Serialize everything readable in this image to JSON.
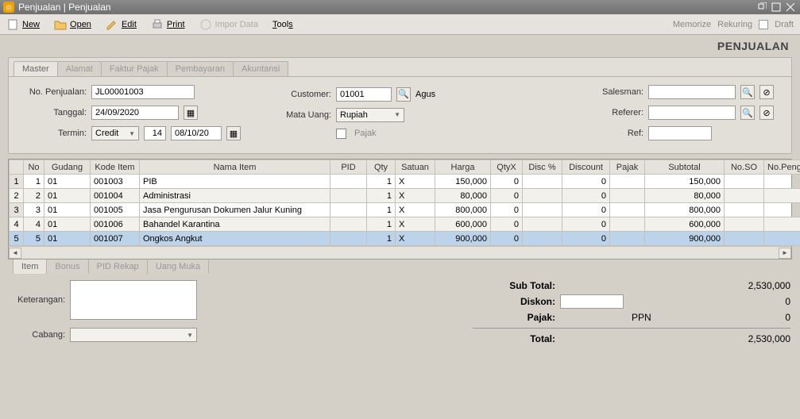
{
  "window": {
    "title": "Penjualan | Penjualan"
  },
  "toolbar": {
    "new": "New",
    "open": "Open",
    "edit": "Edit",
    "print": "Print",
    "impor": "Impor Data",
    "tools": "Tools",
    "memorize": "Memorize",
    "rekuring": "Rekuring",
    "draft": "Draft"
  },
  "page": {
    "title": "PENJUALAN"
  },
  "tabs_top": [
    "Master",
    "Alamat",
    "Faktur Pajak",
    "Pembayaran",
    "Akuntansi"
  ],
  "form": {
    "no_penjualan_label": "No. Penjualan:",
    "no_penjualan": "JL00001003",
    "tanggal_label": "Tanggal:",
    "tanggal": "24/09/2020",
    "termin_label": "Termin:",
    "termin_mode": "Credit",
    "termin_days": "14",
    "termin_due": "08/10/20",
    "customer_label": "Customer:",
    "customer_code": "01001",
    "customer_name": "Agus",
    "matauang_label": "Mata Uang:",
    "matauang": "Rupiah",
    "pajak_label": "Pajak",
    "salesman_label": "Salesman:",
    "salesman": "",
    "referer_label": "Referer:",
    "referer": "",
    "ref_label": "Ref:",
    "ref": ""
  },
  "grid": {
    "headers": [
      "No",
      "Gudang",
      "Kode Item",
      "Nama Item",
      "PID",
      "Qty",
      "Satuan",
      "Harga",
      "QtyX",
      "Disc %",
      "Discount",
      "Pajak",
      "Subtotal",
      "No.SO",
      "No.Pengir"
    ],
    "rows": [
      {
        "no": "1",
        "gudang": "01",
        "kode": "001003",
        "nama": "PIB",
        "pid": "",
        "qty": "1",
        "sat": "X",
        "harga": "150,000",
        "qtyx": "0",
        "discp": "",
        "disc": "0",
        "pajak": "",
        "subtotal": "150,000",
        "noso": "",
        "nopeng": ""
      },
      {
        "no": "2",
        "gudang": "01",
        "kode": "001004",
        "nama": "Administrasi",
        "pid": "",
        "qty": "1",
        "sat": "X",
        "harga": "80,000",
        "qtyx": "0",
        "discp": "",
        "disc": "0",
        "pajak": "",
        "subtotal": "80,000",
        "noso": "",
        "nopeng": ""
      },
      {
        "no": "3",
        "gudang": "01",
        "kode": "001005",
        "nama": "Jasa Pengurusan Dokumen Jalur Kuning",
        "pid": "",
        "qty": "1",
        "sat": "X",
        "harga": "800,000",
        "qtyx": "0",
        "discp": "",
        "disc": "0",
        "pajak": "",
        "subtotal": "800,000",
        "noso": "",
        "nopeng": ""
      },
      {
        "no": "4",
        "gudang": "01",
        "kode": "001006",
        "nama": "Bahandel Karantina",
        "pid": "",
        "qty": "1",
        "sat": "X",
        "harga": "600,000",
        "qtyx": "0",
        "discp": "",
        "disc": "0",
        "pajak": "",
        "subtotal": "600,000",
        "noso": "",
        "nopeng": ""
      },
      {
        "no": "5",
        "gudang": "01",
        "kode": "001007",
        "nama": "Ongkos Angkut",
        "pid": "",
        "qty": "1",
        "sat": "X",
        "harga": "900,000",
        "qtyx": "0",
        "discp": "",
        "disc": "0",
        "pajak": "",
        "subtotal": "900,000",
        "noso": "",
        "nopeng": ""
      }
    ]
  },
  "tabs_bottom": [
    "Item",
    "Bonus",
    "PID Rekap",
    "Uang Muka"
  ],
  "footer": {
    "keterangan_label": "Keterangan:",
    "keterangan": "",
    "cabang_label": "Cabang:",
    "cabang": ""
  },
  "totals": {
    "subtotal_label": "Sub Total:",
    "subtotal": "2,530,000",
    "diskon_label": "Diskon:",
    "diskon_input": "",
    "diskon_val": "0",
    "pajak_label": "Pajak:",
    "pajak_name": "PPN",
    "pajak_val": "0",
    "total_label": "Total:",
    "total": "2,530,000"
  }
}
